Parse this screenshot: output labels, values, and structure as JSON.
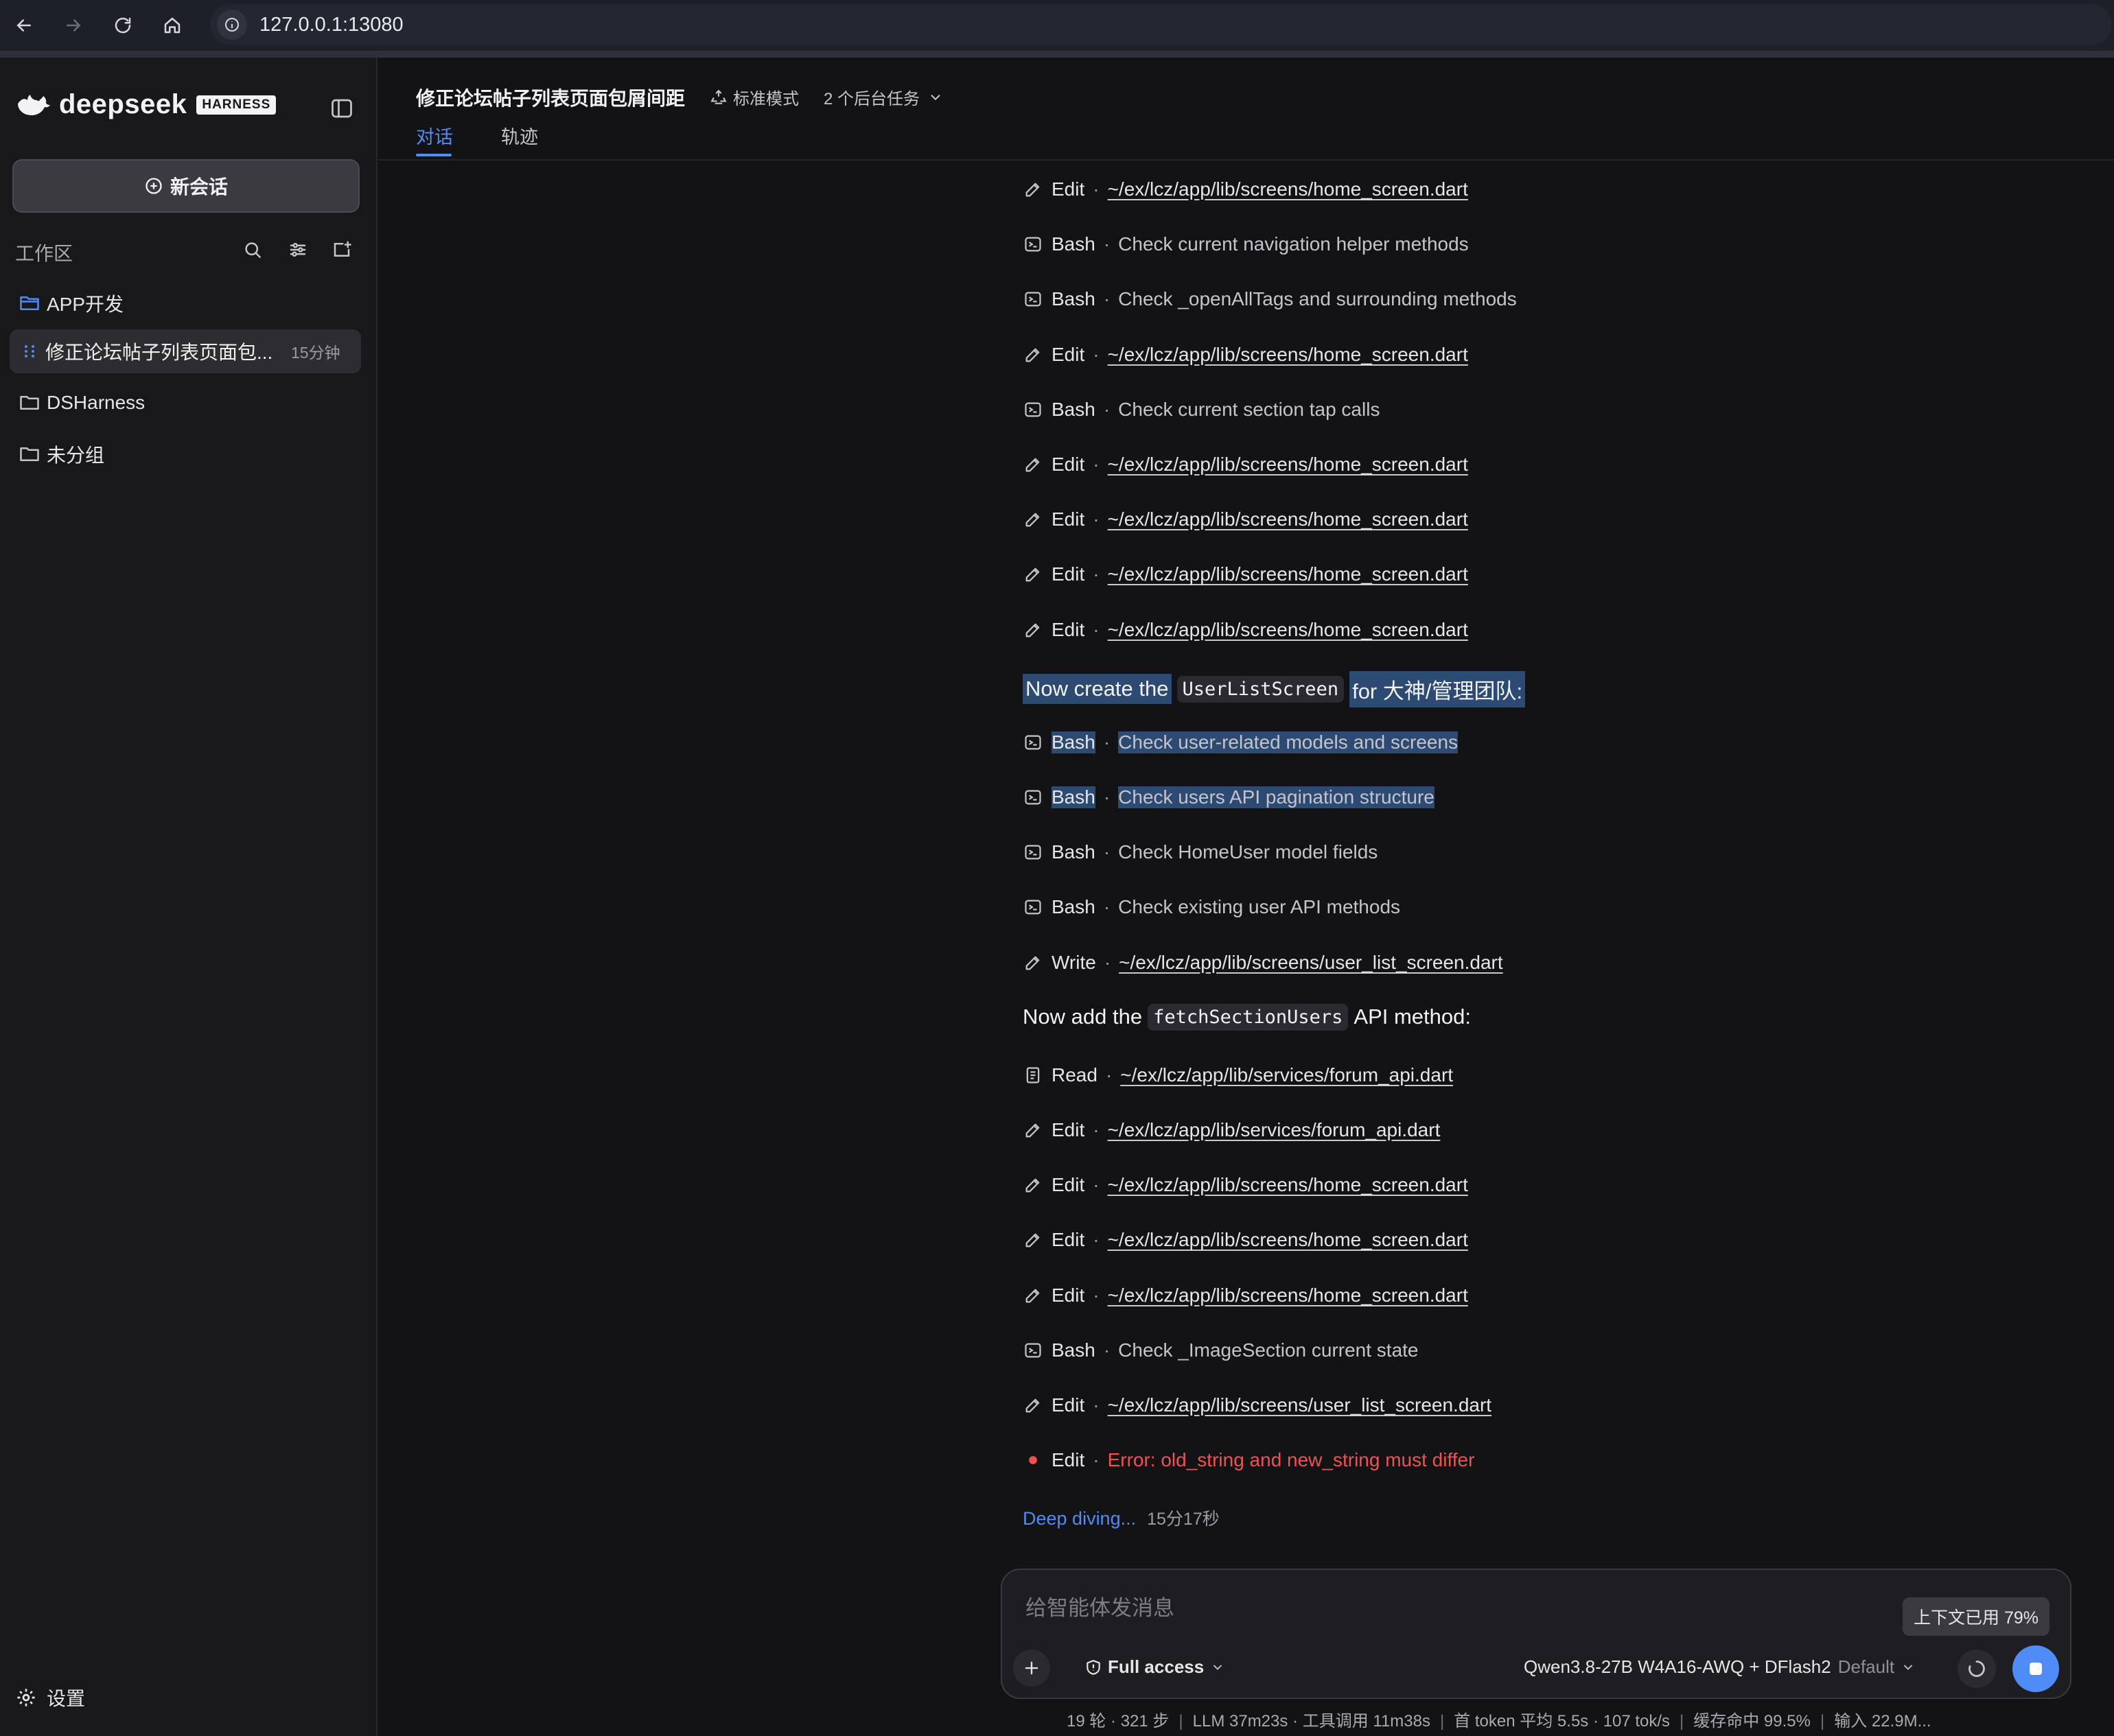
{
  "browser": {
    "url": "127.0.0.1:13080"
  },
  "sidebar": {
    "logo_text": "deepseek",
    "logo_badge": "HARNESS",
    "new_chat_label": "新会话",
    "workspace_label": "工作区",
    "groups": [
      {
        "label": "APP开发"
      },
      {
        "label": "DSHarness"
      },
      {
        "label": "未分组"
      }
    ],
    "active_session": {
      "label": "修正论坛帖子列表页面包...",
      "time": "15分钟"
    },
    "settings_label": "设置"
  },
  "header": {
    "title": "修正论坛帖子列表页面包屑间距",
    "mode": "标准模式",
    "background_tasks": "2 个后台任务",
    "tabs": [
      {
        "label": "对话",
        "active": true
      },
      {
        "label": "轨迹",
        "active": false
      }
    ]
  },
  "conversation": {
    "sep": "·",
    "steps": [
      {
        "icon": "edit-icon",
        "tool": "Edit",
        "text": "~/ex/lcz/app/lib/screens/home_screen.dart",
        "kind": "path"
      },
      {
        "icon": "terminal-icon",
        "tool": "Bash",
        "text": "Check current navigation helper methods",
        "kind": "desc"
      },
      {
        "icon": "terminal-icon",
        "tool": "Bash",
        "text": "Check _openAllTags and surrounding methods",
        "kind": "desc"
      },
      {
        "icon": "edit-icon",
        "tool": "Edit",
        "text": "~/ex/lcz/app/lib/screens/home_screen.dart",
        "kind": "path"
      },
      {
        "icon": "terminal-icon",
        "tool": "Bash",
        "text": "Check current section tap calls",
        "kind": "desc"
      },
      {
        "icon": "edit-icon",
        "tool": "Edit",
        "text": "~/ex/lcz/app/lib/screens/home_screen.dart",
        "kind": "path"
      },
      {
        "icon": "edit-icon",
        "tool": "Edit",
        "text": "~/ex/lcz/app/lib/screens/home_screen.dart",
        "kind": "path"
      },
      {
        "icon": "edit-icon",
        "tool": "Edit",
        "text": "~/ex/lcz/app/lib/screens/home_screen.dart",
        "kind": "path"
      },
      {
        "icon": "edit-icon",
        "tool": "Edit",
        "text": "~/ex/lcz/app/lib/screens/home_screen.dart",
        "kind": "path"
      }
    ],
    "prose1": {
      "before": "Now create the",
      "code": "UserListScreen",
      "after": "for 大神/管理团队:"
    },
    "steps2": [
      {
        "icon": "terminal-icon",
        "tool": "Bash",
        "text": "Check user-related models and screens",
        "kind": "desc",
        "highlight": true
      },
      {
        "icon": "terminal-icon",
        "tool": "Bash",
        "text": "Check users API pagination structure",
        "kind": "desc",
        "highlight": true
      },
      {
        "icon": "terminal-icon",
        "tool": "Bash",
        "text": "Check HomeUser model fields",
        "kind": "desc"
      },
      {
        "icon": "terminal-icon",
        "tool": "Bash",
        "text": "Check existing user API methods",
        "kind": "desc"
      },
      {
        "icon": "edit-icon",
        "tool": "Write",
        "text": "~/ex/lcz/app/lib/screens/user_list_screen.dart",
        "kind": "path"
      }
    ],
    "prose2": {
      "before": "Now add the",
      "code": "fetchSectionUsers",
      "after": "API method:"
    },
    "steps3": [
      {
        "icon": "file-icon",
        "tool": "Read",
        "text": "~/ex/lcz/app/lib/services/forum_api.dart",
        "kind": "path"
      },
      {
        "icon": "edit-icon",
        "tool": "Edit",
        "text": "~/ex/lcz/app/lib/services/forum_api.dart",
        "kind": "path"
      },
      {
        "icon": "edit-icon",
        "tool": "Edit",
        "text": "~/ex/lcz/app/lib/screens/home_screen.dart",
        "kind": "path"
      },
      {
        "icon": "edit-icon",
        "tool": "Edit",
        "text": "~/ex/lcz/app/lib/screens/home_screen.dart",
        "kind": "path"
      },
      {
        "icon": "edit-icon",
        "tool": "Edit",
        "text": "~/ex/lcz/app/lib/screens/home_screen.dart",
        "kind": "path"
      },
      {
        "icon": "terminal-icon",
        "tool": "Bash",
        "text": "Check _ImageSection current state",
        "kind": "desc"
      },
      {
        "icon": "edit-icon",
        "tool": "Edit",
        "text": "~/ex/lcz/app/lib/screens/user_list_screen.dart",
        "kind": "path"
      },
      {
        "icon": "error-dot-icon",
        "tool": "Edit",
        "text": "Error: old_string and new_string must differ",
        "kind": "error"
      }
    ],
    "status": {
      "label": "Deep diving...",
      "elapsed": "15分17秒"
    }
  },
  "composer": {
    "placeholder": "给智能体发消息",
    "context_usage": "上下文已用 79%",
    "access_label": "Full access",
    "model_name": "Qwen3.8-27B W4A16-AWQ + DFlash2",
    "model_profile": "Default"
  },
  "stats": [
    "19 轮 · 321 步",
    "LLM 37m23s · 工具调用 11m38s",
    "首 token 平均 5.5s · 107 tok/s",
    "缓存命中 99.5%",
    "输入 22.9M..."
  ],
  "colors": {
    "accent": "#4f8cf7",
    "error": "#f05252",
    "highlight": "#2d4a72",
    "background": "#131316"
  }
}
